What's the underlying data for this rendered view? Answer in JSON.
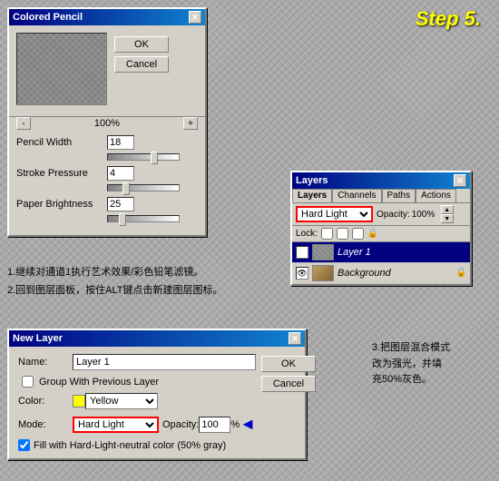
{
  "step_label": "Step 5.",
  "colored_pencil": {
    "title": "Colored Pencil",
    "ok_label": "OK",
    "cancel_label": "Cancel",
    "zoom_percent": "100%",
    "zoom_minus": "-",
    "zoom_plus": "+",
    "pencil_width_label": "Pencil Width",
    "pencil_width_value": "18",
    "stroke_pressure_label": "Stroke Pressure",
    "stroke_pressure_value": "4",
    "paper_brightness_label": "Paper Brightness",
    "paper_brightness_value": "25"
  },
  "layers_panel": {
    "title": "Layers",
    "tabs": [
      "Layers",
      "Channels",
      "Paths",
      "Actions"
    ],
    "blend_mode": "Hard Light",
    "opacity_label": "Opacity:",
    "opacity_value": "100%",
    "lock_label": "Lock:",
    "layer1_name": "Layer 1",
    "background_name": "Background"
  },
  "new_layer": {
    "title": "New Layer",
    "ok_label": "OK",
    "cancel_label": "Cancel",
    "name_label": "Name:",
    "name_value": "Layer 1",
    "group_label": "Group With Previous Layer",
    "color_label": "Color:",
    "color_value": "Yellow",
    "mode_label": "Mode:",
    "mode_value": "Hard Light",
    "opacity_label": "Opacity:",
    "opacity_value": "100",
    "percent": "%",
    "fill_label": "Fill with Hard-Light-neutral color (50% gray)"
  },
  "instructions": {
    "line1": "1.继续对通道1执行艺术效果/彩色铅笔滤镜。",
    "line2": "2.回到图层面板，按住ALT键点击新建图层图标。",
    "side": "3.把图层混合模式\n改为强光，并填\n充50%灰色。"
  }
}
